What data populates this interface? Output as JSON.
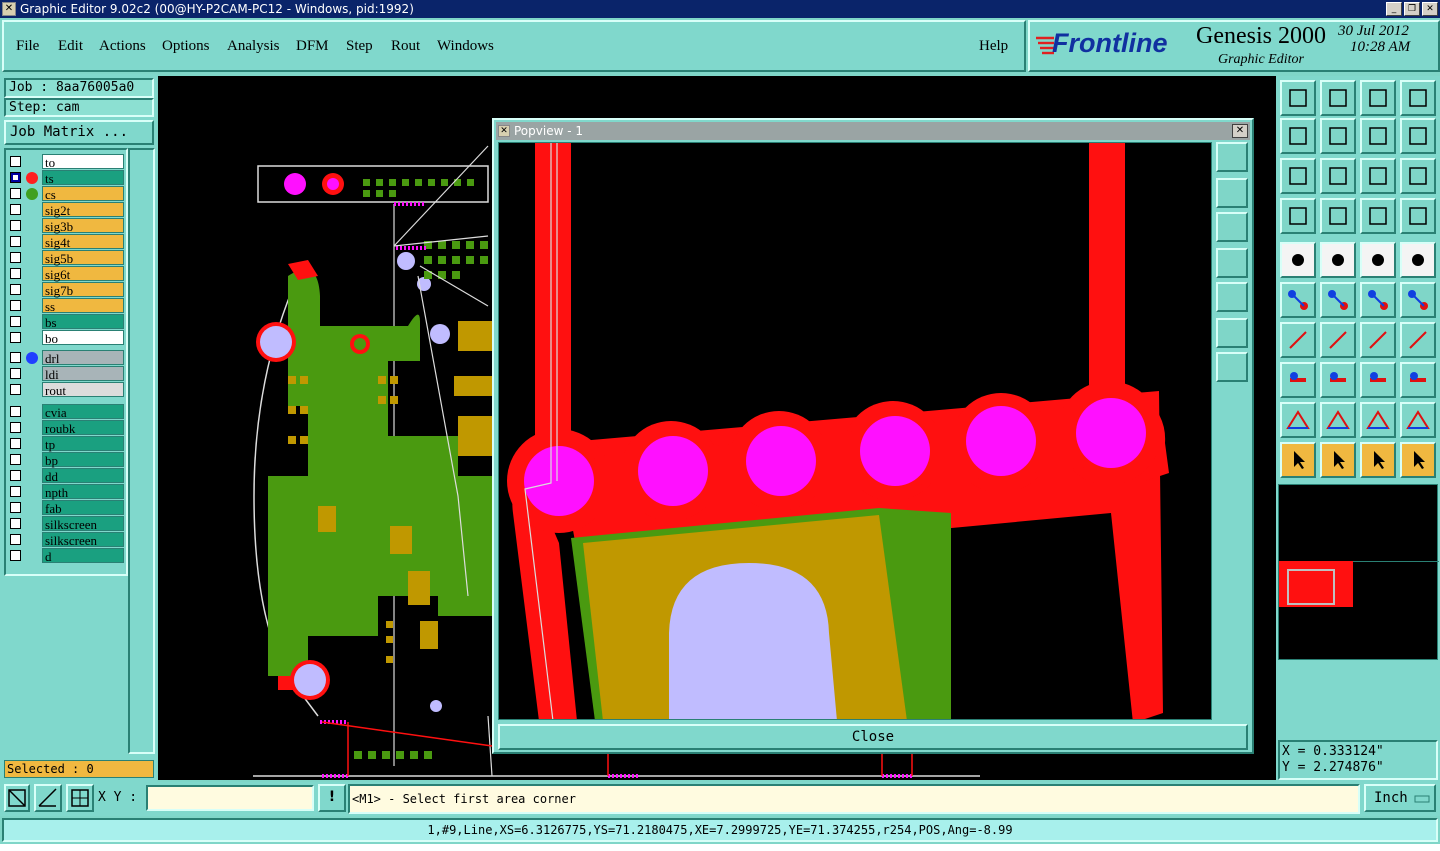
{
  "window": {
    "title": "Graphic Editor 9.02c2 (00@HY-P2CAM-PC12 - Windows, pid:1992)"
  },
  "menu": [
    "File",
    "Edit",
    "Actions",
    "Options",
    "Analysis",
    "DFM",
    "Step",
    "Rout",
    "Windows"
  ],
  "help": "Help",
  "brand": {
    "logo": "Frontline",
    "product": "Genesis 2000",
    "subtitle": "Graphic Editor",
    "date": "30 Jul 2012",
    "time": "10:28 AM"
  },
  "job": {
    "job_label": "Job : 8aa76005a0",
    "step_label": "Step: cam",
    "matrix_button": "Job Matrix ..."
  },
  "layers": [
    {
      "name": "to",
      "color": "#ffffff",
      "dot": ""
    },
    {
      "name": "ts",
      "color": "#1aa080",
      "dot": "#ff2020",
      "active": true
    },
    {
      "name": "cs",
      "color": "#f0b840",
      "dot": "#40a020"
    },
    {
      "name": "sig2t",
      "color": "#f0b840",
      "dot": ""
    },
    {
      "name": "sig3b",
      "color": "#f0b840",
      "dot": ""
    },
    {
      "name": "sig4t",
      "color": "#f0b840",
      "dot": ""
    },
    {
      "name": "sig5b",
      "color": "#f0b840",
      "dot": ""
    },
    {
      "name": "sig6t",
      "color": "#f0b840",
      "dot": ""
    },
    {
      "name": "sig7b",
      "color": "#f0b840",
      "dot": ""
    },
    {
      "name": "ss",
      "color": "#f0b840",
      "dot": ""
    },
    {
      "name": "bs",
      "color": "#1aa080",
      "dot": ""
    },
    {
      "name": "bo",
      "color": "#ffffff",
      "dot": ""
    },
    {
      "name": "drl",
      "color": "#a8b4b8",
      "dot": "#2040ff"
    },
    {
      "name": "ldi",
      "color": "#a8b4b8",
      "dot": ""
    },
    {
      "name": "rout",
      "color": "#dcdcdc",
      "dot": ""
    },
    {
      "name": "cvia",
      "color": "#1aa080",
      "dot": ""
    },
    {
      "name": "roubk",
      "color": "#1aa080",
      "dot": ""
    },
    {
      "name": "tp",
      "color": "#1aa080",
      "dot": ""
    },
    {
      "name": "bp",
      "color": "#1aa080",
      "dot": ""
    },
    {
      "name": "dd",
      "color": "#1aa080",
      "dot": ""
    },
    {
      "name": "npth",
      "color": "#1aa080",
      "dot": ""
    },
    {
      "name": "fab",
      "color": "#1aa080",
      "dot": ""
    },
    {
      "name": "silkscreen",
      "color": "#1aa080",
      "dot": ""
    },
    {
      "name": "silkscreen",
      "color": "#1aa080",
      "dot": ""
    },
    {
      "name": "d",
      "color": "#1aa080",
      "dot": ""
    }
  ],
  "selected": "Selected : 0",
  "popview": {
    "title": "Popview - 1",
    "close": "Close"
  },
  "coords": {
    "x": "X = 0.333124\"",
    "y": "Y = 2.274876\""
  },
  "command": {
    "xy_label": "X Y :",
    "xy_value": "",
    "prompt": "<M1> - Select first area corner",
    "units": "Inch"
  },
  "status": "1,#9,Line,XS=6.3126775,YS=71.2180475,XE=7.2999725,YE=71.374255,r254,POS,Ang=-8.99",
  "colors": {
    "copper_red": "#ff1010",
    "pad_magenta": "#ff10ff",
    "green": "#4a9a10",
    "gold": "#c09800",
    "lavender": "#c0bcff"
  }
}
